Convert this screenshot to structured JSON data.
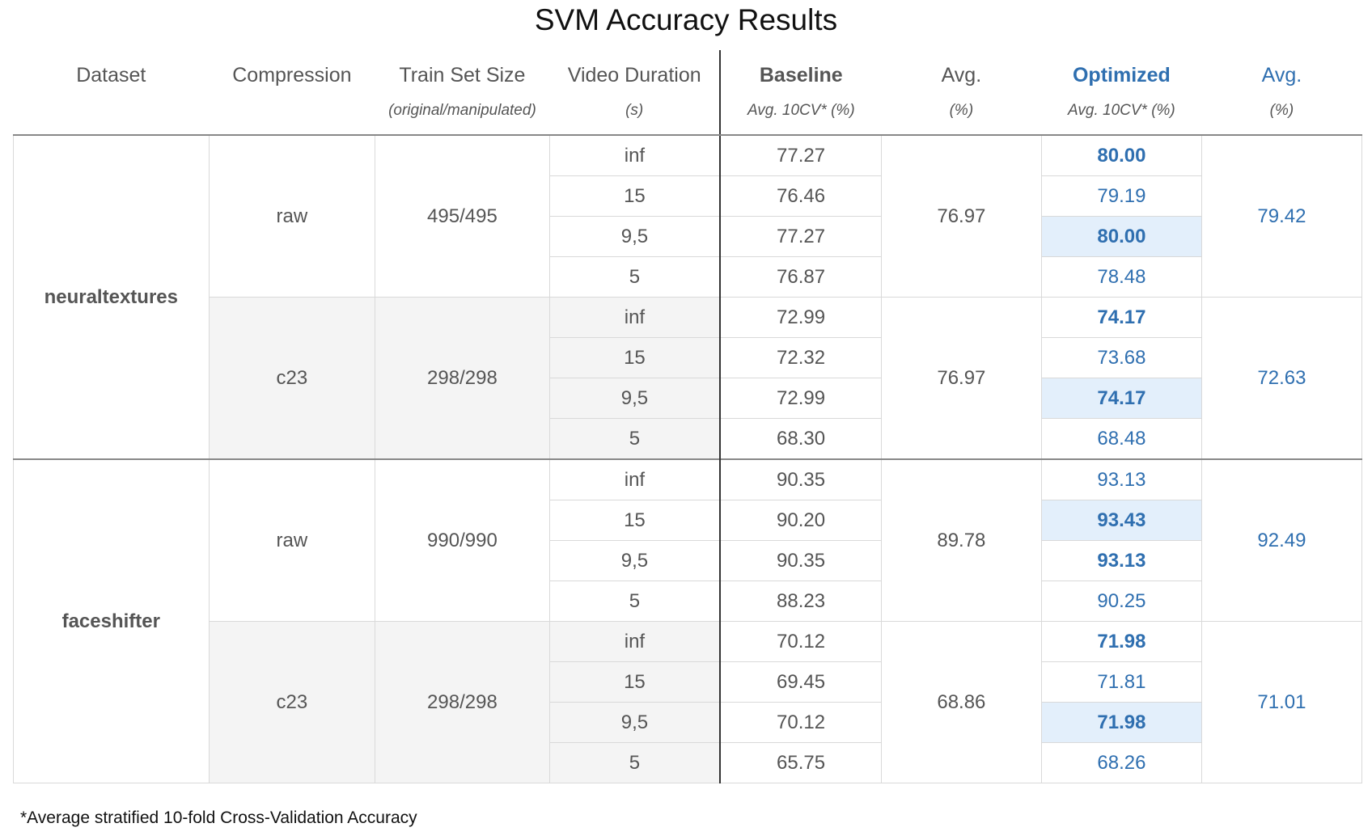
{
  "title": "SVM Accuracy Results",
  "header": {
    "dataset": "Dataset",
    "compression": "Compression",
    "train_set_size": "Train Set Size",
    "train_set_size_sub": "(original/manipulated)",
    "video_duration": "Video Duration",
    "video_duration_sub": "(s)",
    "baseline": "Baseline",
    "baseline_sub": "Avg. 10CV* (%)",
    "avg1": "Avg.",
    "avg1_sub": "(%)",
    "optimized": "Optimized",
    "optimized_sub": "Avg. 10CV* (%)",
    "avg2": "Avg.",
    "avg2_sub": "(%)"
  },
  "rows": [
    {
      "duration": "inf",
      "baseline": "77.27",
      "optimized": "80.00"
    },
    {
      "duration": "15",
      "baseline": "76.46",
      "optimized": "79.19"
    },
    {
      "duration": "9,5",
      "baseline": "77.27",
      "optimized": "80.00"
    },
    {
      "duration": "5",
      "baseline": "76.87",
      "optimized": "78.48"
    },
    {
      "duration": "inf",
      "baseline": "72.99",
      "optimized": "74.17"
    },
    {
      "duration": "15",
      "baseline": "72.32",
      "optimized": "73.68"
    },
    {
      "duration": "9,5",
      "baseline": "72.99",
      "optimized": "74.17"
    },
    {
      "duration": "5",
      "baseline": "68.30",
      "optimized": "68.48"
    },
    {
      "duration": "inf",
      "baseline": "90.35",
      "optimized": "93.13"
    },
    {
      "duration": "15",
      "baseline": "90.20",
      "optimized": "93.43"
    },
    {
      "duration": "9,5",
      "baseline": "90.35",
      "optimized": "93.13"
    },
    {
      "duration": "5",
      "baseline": "88.23",
      "optimized": "90.25"
    },
    {
      "duration": "inf",
      "baseline": "70.12",
      "optimized": "71.98"
    },
    {
      "duration": "15",
      "baseline": "69.45",
      "optimized": "71.81"
    },
    {
      "duration": "9,5",
      "baseline": "70.12",
      "optimized": "71.98"
    },
    {
      "duration": "5",
      "baseline": "65.75",
      "optimized": "68.26"
    }
  ],
  "datasets": [
    {
      "name": "neuraltextures",
      "groups": [
        {
          "compression": "raw",
          "train_size": "495/495",
          "baseline_avg": "76.97",
          "optimized_avg": "79.42"
        },
        {
          "compression": "c23",
          "train_size": "298/298",
          "baseline_avg": "76.97",
          "optimized_avg": "72.63"
        }
      ]
    },
    {
      "name": "faceshifter",
      "groups": [
        {
          "compression": "raw",
          "train_size": "990/990",
          "baseline_avg": "89.78",
          "optimized_avg": "92.49"
        },
        {
          "compression": "c23",
          "train_size": "298/298",
          "baseline_avg": "68.86",
          "optimized_avg": "71.01"
        }
      ]
    }
  ],
  "footnote": "*Average stratified 10-fold Cross-Validation Accuracy",
  "colors": {
    "optimized_text": "#2f6fb0",
    "highlight": "#e3effb",
    "grey_group": "#f4f4f4"
  }
}
